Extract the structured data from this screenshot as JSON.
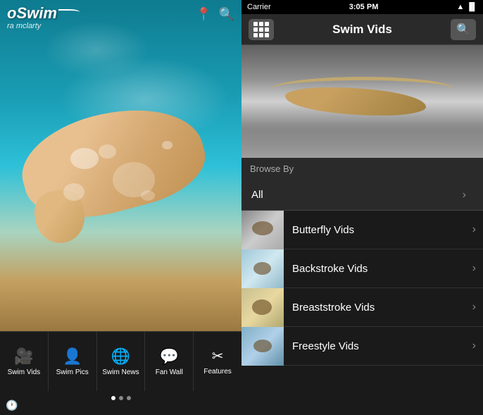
{
  "left": {
    "logo_main": "oSwim",
    "logo_sub": "ra mclarty",
    "tab_items": [
      {
        "id": "swim-vids",
        "label": "Swim Vids",
        "icon": "🎥"
      },
      {
        "id": "swim-pics",
        "label": "Swim Pics",
        "icon": "👤"
      },
      {
        "id": "swim-news",
        "label": "Swim News",
        "icon": "🌐"
      },
      {
        "id": "fan-wall",
        "label": "Fan Wall",
        "icon": "💬"
      },
      {
        "id": "features",
        "label": "Features",
        "icon": "✂"
      }
    ],
    "dots": [
      true,
      false,
      false
    ]
  },
  "right": {
    "status_bar": {
      "left": "Carrier",
      "center": "3:05 PM",
      "right": "battery"
    },
    "header": {
      "title": "Swim Vids",
      "grid_btn_label": "grid",
      "search_btn_label": "search"
    },
    "browse_by_label": "Browse By",
    "browse_items": [
      {
        "id": "all",
        "label": "All",
        "has_thumb": false
      },
      {
        "id": "butterfly",
        "label": "Butterfly Vids",
        "has_thumb": true,
        "thumb_type": "butterfly"
      },
      {
        "id": "backstroke",
        "label": "Backstroke Vids",
        "has_thumb": true,
        "thumb_type": "backstroke"
      },
      {
        "id": "breaststroke",
        "label": "Breaststroke Vids",
        "has_thumb": true,
        "thumb_type": "breaststroke"
      },
      {
        "id": "freestyle",
        "label": "Freestyle Vids",
        "has_thumb": true,
        "thumb_type": "freestyle"
      }
    ]
  }
}
